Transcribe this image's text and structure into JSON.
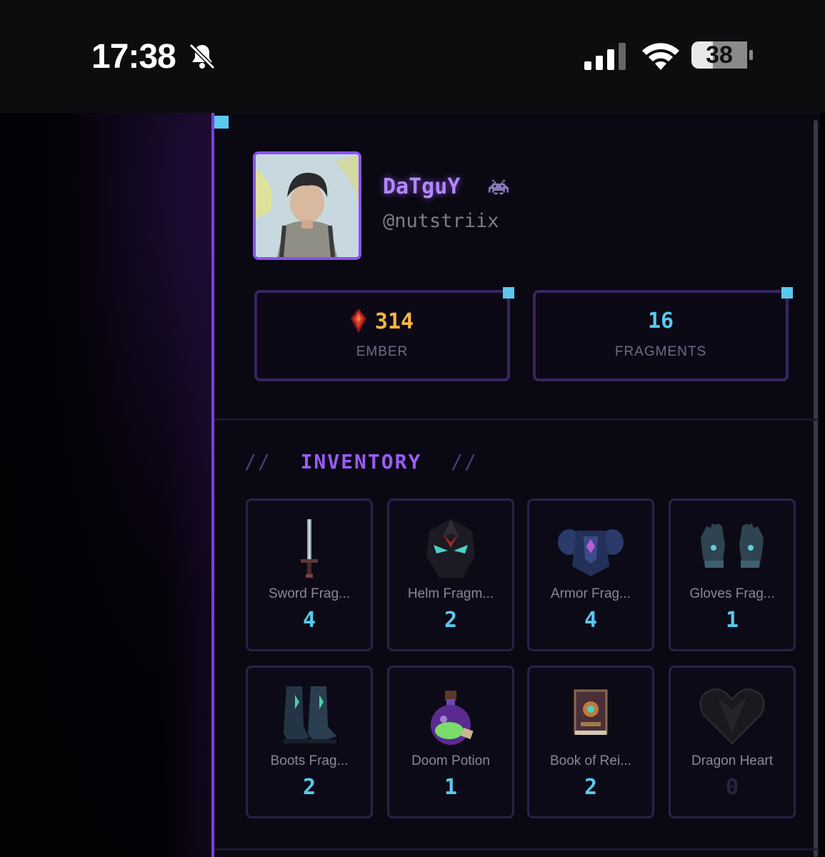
{
  "status_bar": {
    "time": "17:38",
    "battery": "38"
  },
  "profile": {
    "display_name": "DaTguY",
    "handle": "@nutstriix"
  },
  "stats": [
    {
      "value": "314",
      "label": "EMBER",
      "icon": "ember-crystal-icon"
    },
    {
      "value": "16",
      "label": "FRAGMENTS"
    }
  ],
  "inventory": {
    "title": "INVENTORY",
    "items": [
      {
        "name": "Sword Frag...",
        "qty": "4",
        "icon": "sword-icon"
      },
      {
        "name": "Helm Fragm...",
        "qty": "2",
        "icon": "helm-icon"
      },
      {
        "name": "Armor Frag...",
        "qty": "4",
        "icon": "armor-icon"
      },
      {
        "name": "Gloves Frag...",
        "qty": "1",
        "icon": "gloves-icon"
      },
      {
        "name": "Boots Frag...",
        "qty": "2",
        "icon": "boots-icon"
      },
      {
        "name": "Doom Potion",
        "qty": "1",
        "icon": "potion-icon"
      },
      {
        "name": "Book of Rei...",
        "qty": "2",
        "icon": "book-icon"
      },
      {
        "name": "Dragon Heart",
        "qty": "0",
        "icon": "heart-icon"
      }
    ]
  },
  "colors": {
    "accent": "#8a52f0",
    "cyan": "#5bc8ee",
    "gold": "#f5b642"
  }
}
